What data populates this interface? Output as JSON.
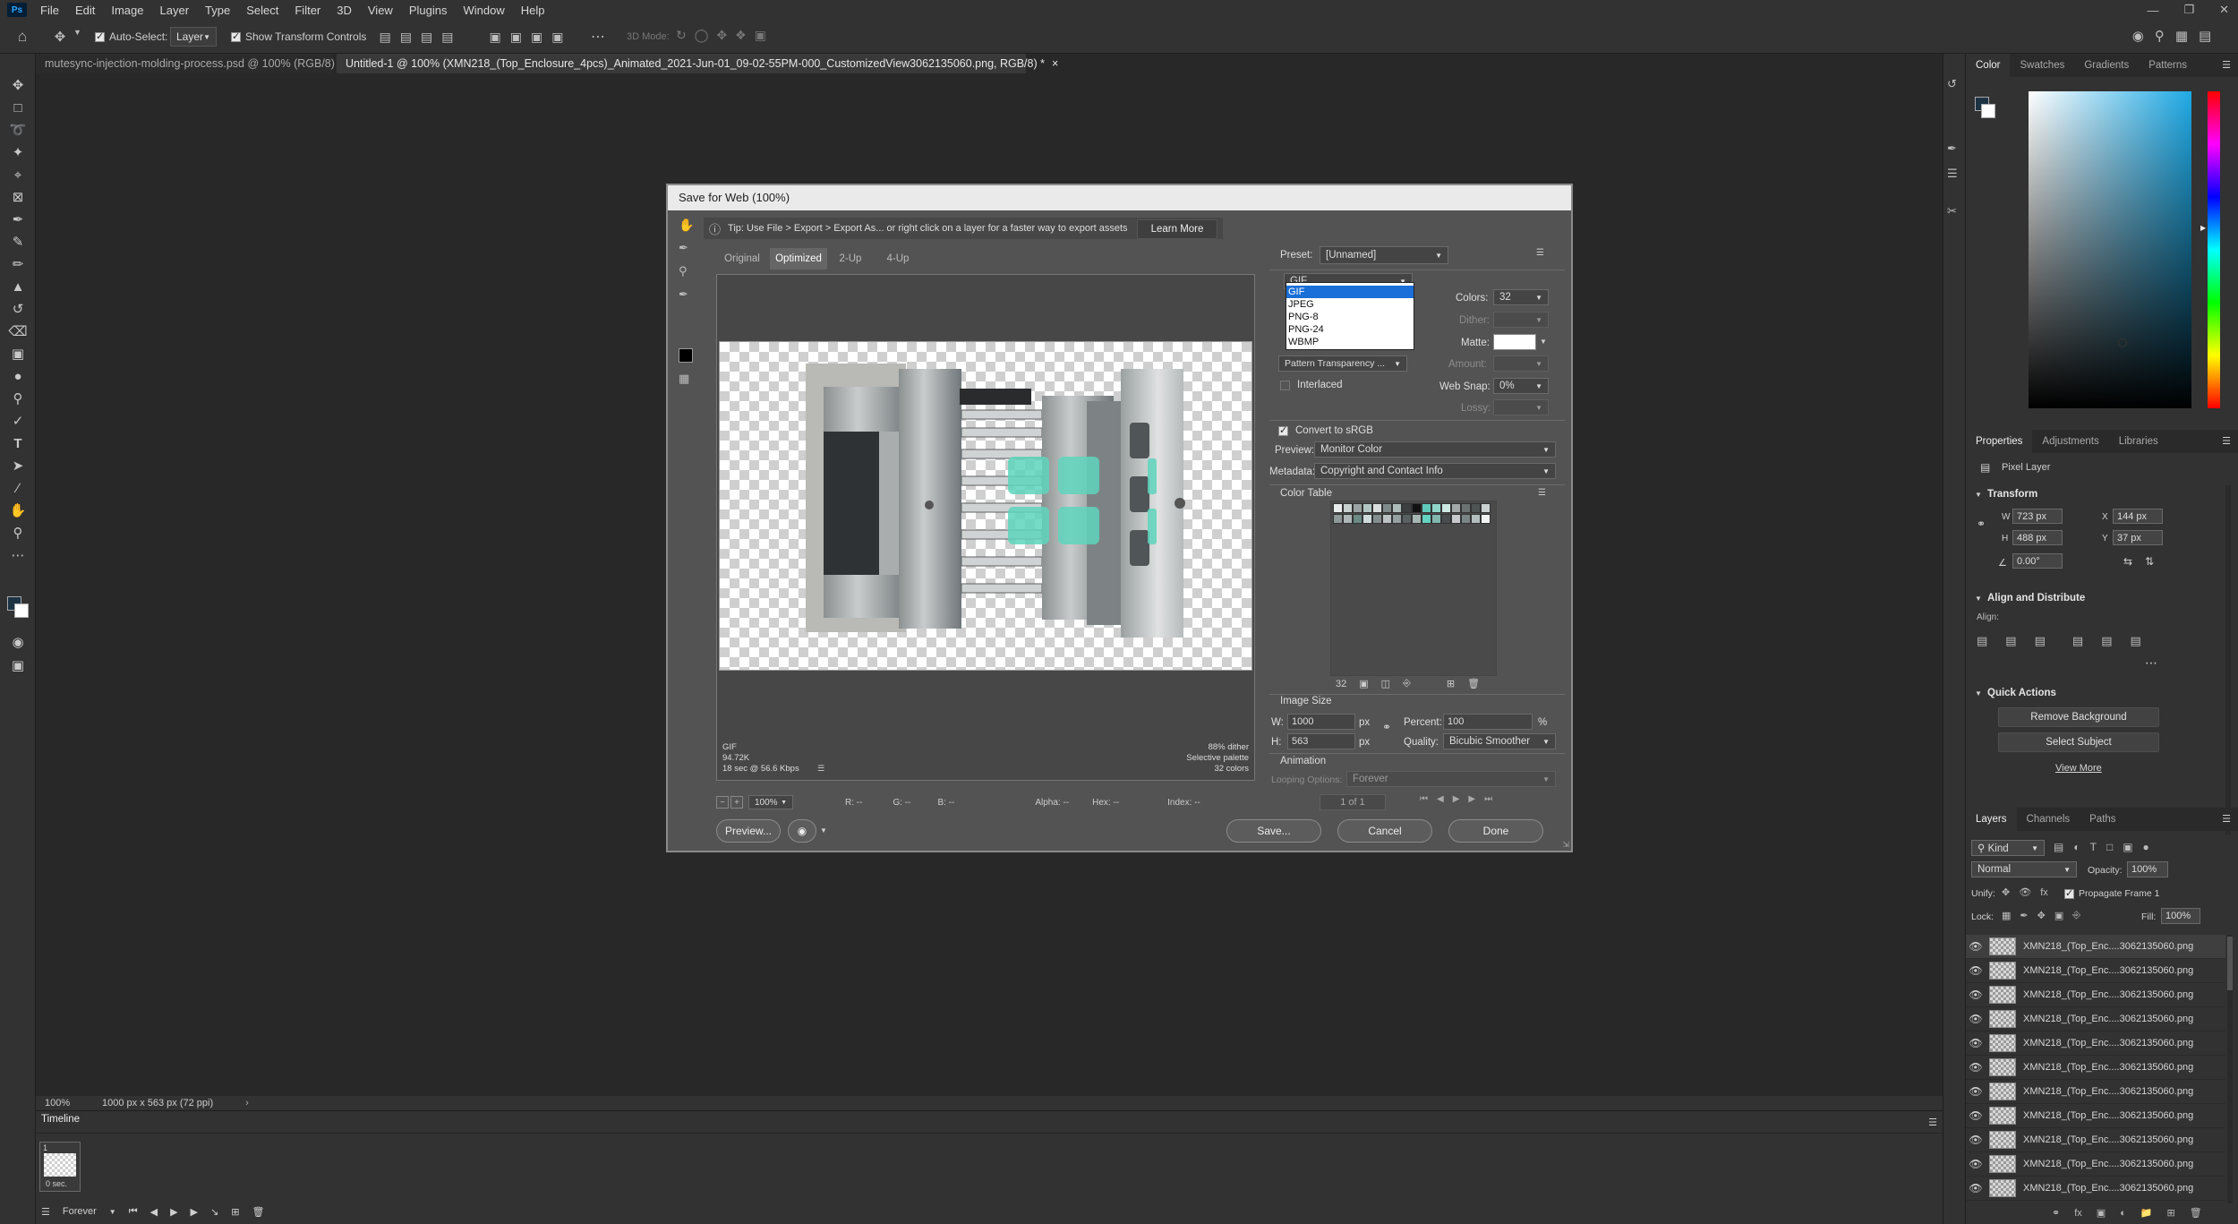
{
  "app": {
    "logo": "Ps"
  },
  "menu": [
    "File",
    "Edit",
    "Image",
    "Layer",
    "Type",
    "Select",
    "Filter",
    "3D",
    "View",
    "Plugins",
    "Window",
    "Help"
  ],
  "options": {
    "auto_select": "Auto-Select:",
    "auto_select_target": "Layer",
    "show_transform": "Show Transform Controls",
    "mode3d": "3D Mode:"
  },
  "tabs": [
    {
      "label": "mutesync-injection-molding-process.psd @ 100% (RGB/8) *"
    },
    {
      "label": "Untitled-1 @ 100% (XMN218_(Top_Enclosure_4pcs)_Animated_2021-Jun-01_09-02-55PM-000_CustomizedView3062135060.png, RGB/8) *"
    }
  ],
  "status": {
    "zoom": "100%",
    "doc_size": "1000 px x 563 px (72 ppi)"
  },
  "timeline": {
    "title": "Timeline",
    "frame_number": "1",
    "frame_delay": "0 sec.",
    "loop": "Forever"
  },
  "dialog": {
    "title": "Save for Web (100%)",
    "tip": "Tip: Use File > Export > Export As...  or right click on a layer for a faster way to export assets",
    "learn_more": "Learn More",
    "view_tabs": [
      "Original",
      "Optimized",
      "2-Up",
      "4-Up"
    ],
    "info_left": [
      "GIF",
      "94.72K",
      "18 sec @ 56.6 Kbps"
    ],
    "info_right": [
      "88% dither",
      "Selective palette",
      "32 colors"
    ],
    "zoom": "100%",
    "readout": {
      "r": "R: --",
      "g": "G: --",
      "b": "B: --",
      "alpha": "Alpha: --",
      "hex": "Hex: --",
      "index": "Index: --"
    },
    "preview_btn": "Preview...",
    "save_btn": "Save...",
    "cancel_btn": "Cancel",
    "done_btn": "Done",
    "preset_label": "Preset:",
    "preset_value": "[Unnamed]",
    "format_value": "GIF",
    "format_options": [
      "GIF",
      "JPEG",
      "PNG-8",
      "PNG-24",
      "WBMP"
    ],
    "colors_label": "Colors:",
    "colors_value": "32",
    "dither_label": "Dither:",
    "matte_label": "Matte:",
    "transparency_dither": "Pattern Transparency ...",
    "amount_label": "Amount:",
    "interlaced": "Interlaced",
    "websnap_label": "Web Snap:",
    "websnap_value": "0%",
    "lossy_label": "Lossy:",
    "convert_srgb": "Convert to sRGB",
    "preview_label": "Preview:",
    "preview_value": "Monitor Color",
    "metadata_label": "Metadata:",
    "metadata_value": "Copyright and Contact Info",
    "color_table": "Color Table",
    "color_count": "32",
    "image_size": "Image Size",
    "w_label": "W:",
    "w_value": "1000",
    "h_label": "H:",
    "h_value": "563",
    "px": "px",
    "percent_label": "Percent:",
    "percent_value": "100",
    "pct": "%",
    "quality_label": "Quality:",
    "quality_value": "Bicubic Smoother",
    "animation": "Animation",
    "looping_label": "Looping Options:",
    "looping_value": "Forever",
    "frame_counter": "1 of 1",
    "swatches": [
      "#e9ecec",
      "#c7cfcf",
      "#9aa3a3",
      "#b2c7c3",
      "#d9dddd",
      "#7f8a8a",
      "#adbab8",
      "#3b3f40",
      "#111111",
      "#5fcab8",
      "#8fd6c9",
      "#cde9e3",
      "#a3a8a8",
      "#6c7272",
      "#4e5353",
      "#cbd1d1",
      "#8e9898",
      "#aeb6b6",
      "#6b8b86",
      "#cfdcd9",
      "#868f8f",
      "#bcc3c3",
      "#96a0a0",
      "#5a6161",
      "#a7b5b3",
      "#64d2bf",
      "#82b7ae",
      "#484c4c",
      "#c6caca",
      "#7b8585",
      "#b3bdbd",
      "#f2f4f4"
    ]
  },
  "color_panel": {
    "tabs": [
      "Color",
      "Swatches",
      "Gradients",
      "Patterns"
    ]
  },
  "properties": {
    "tabs": [
      "Properties",
      "Adjustments",
      "Libraries"
    ],
    "kind": "Pixel Layer",
    "transform": "Transform",
    "w": "723 px",
    "x": "144 px",
    "h": "488 px",
    "y": "37 px",
    "angle": "0.00°",
    "align": "Align and Distribute",
    "align_sub": "Align:",
    "quick_actions": "Quick Actions",
    "remove_bg": "Remove Background",
    "select_subject": "Select Subject",
    "view_more": "View More"
  },
  "layers_panel": {
    "tabs": [
      "Layers",
      "Channels",
      "Paths"
    ],
    "kind": "Kind",
    "blend": "Normal",
    "opacity_label": "Opacity:",
    "opacity": "100%",
    "unify": "Unify:",
    "propagate": "Propagate Frame 1",
    "lock": "Lock:",
    "fill_label": "Fill:",
    "fill": "100%",
    "layers": [
      "XMN218_(Top_Enc....3062135060.png",
      "XMN218_(Top_Enc....3062135060.png",
      "XMN218_(Top_Enc....3062135060.png",
      "XMN218_(Top_Enc....3062135060.png",
      "XMN218_(Top_Enc....3062135060.png",
      "XMN218_(Top_Enc....3062135060.png",
      "XMN218_(Top_Enc....3062135060.png",
      "XMN218_(Top_Enc....3062135060.png",
      "XMN218_(Top_Enc....3062135060.png",
      "XMN218_(Top_Enc....3062135060.png",
      "XMN218_(Top_Enc....3062135060.png"
    ]
  }
}
